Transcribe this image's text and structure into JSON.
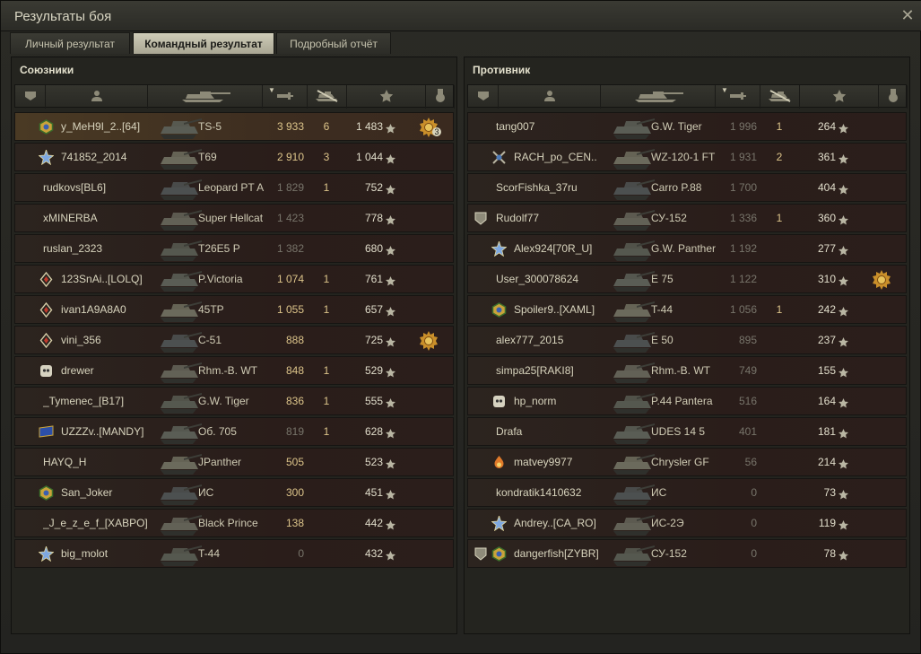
{
  "window": {
    "title": "Результаты боя",
    "close": "✕"
  },
  "tabs": [
    {
      "label": "Личный результат",
      "active": false
    },
    {
      "label": "Командный результат",
      "active": true
    },
    {
      "label": "Подробный отчёт",
      "active": false
    }
  ],
  "columns": [
    "rank-icon",
    "player-icon",
    "tank-icon",
    "damage-icon",
    "kills-icon",
    "experience-icon",
    "medal-icon"
  ],
  "colors": {
    "accent": "#dcc48a",
    "row_bg": "#2a1d1a",
    "highlight": "#4a3a24"
  },
  "allies": {
    "title": "Союзники",
    "players": [
      {
        "name": "y_MeH9I_2..[64]",
        "tank": "TS-5",
        "damage": "3 933",
        "kills": "6",
        "xp": "1 483",
        "badge": "hex-badge",
        "medal": "medal-icon",
        "medal_count": "3",
        "highlight": true
      },
      {
        "name": "741852_2014",
        "tank": "T69",
        "damage": "2 910",
        "kills": "3",
        "xp": "1 044",
        "badge": "star-badge"
      },
      {
        "name": "rudkovs[BL6]",
        "tank": "Leopard PT A",
        "damage": "1 829",
        "kills": "1",
        "xp": "752",
        "dim": true
      },
      {
        "name": "xMINERBA",
        "tank": "Super Hellcat",
        "damage": "1 423",
        "kills": "",
        "xp": "778",
        "dim": true
      },
      {
        "name": "ruslan_2323",
        "tank": "T26E5 P",
        "damage": "1 382",
        "kills": "",
        "xp": "680",
        "dim": true
      },
      {
        "name": "123SnAi..[LOLQ]",
        "tank": "P.Victoria",
        "damage": "1 074",
        "kills": "1",
        "xp": "761",
        "badge": "diamond-badge"
      },
      {
        "name": "ivan1A9A8A0",
        "tank": "45TP",
        "damage": "1 055",
        "kills": "1",
        "xp": "657",
        "badge": "diamond-badge"
      },
      {
        "name": "vini_356",
        "tank": "C-51",
        "damage": "888",
        "kills": "",
        "xp": "725",
        "badge": "diamond-badge",
        "medal": "medal-icon"
      },
      {
        "name": "drewer",
        "tank": "Rhm.-B. WT",
        "damage": "848",
        "kills": "1",
        "xp": "529",
        "badge": "skull-badge"
      },
      {
        "name": "_Tymenec_[B17]",
        "tank": "G.W. Tiger",
        "damage": "836",
        "kills": "1",
        "xp": "555"
      },
      {
        "name": "UZZZv..[MANDY]",
        "tank": "Об. 705",
        "damage": "819",
        "kills": "1",
        "xp": "628",
        "badge": "flag-badge",
        "dim": true
      },
      {
        "name": "HAYQ_H",
        "tank": "JPanther",
        "damage": "505",
        "kills": "",
        "xp": "523"
      },
      {
        "name": "San_Joker",
        "tank": "ИС",
        "damage": "300",
        "kills": "",
        "xp": "451",
        "badge": "hex-badge"
      },
      {
        "name": "_J_e_z_e_f_[XABPO]",
        "tank": "Black Prince",
        "damage": "138",
        "kills": "",
        "xp": "442"
      },
      {
        "name": "big_molot",
        "tank": "T-44",
        "damage": "0",
        "kills": "",
        "xp": "432",
        "badge": "star-badge",
        "dim": true
      }
    ]
  },
  "enemies": {
    "title": "Противник",
    "players": [
      {
        "name": "tang007",
        "tank": "G.W. Tiger",
        "damage": "1 996",
        "kills": "1",
        "xp": "264",
        "dim": true
      },
      {
        "name": "RACH_po_CEN..",
        "tank": "WZ-120-1 FT",
        "damage": "1 931",
        "kills": "2",
        "xp": "361",
        "badge": "crossed-badge",
        "dim": true
      },
      {
        "name": "ScorFishka_37ru",
        "tank": "Carro P.88",
        "damage": "1 700",
        "kills": "",
        "xp": "404",
        "dim": true
      },
      {
        "name": "Rudolf77",
        "tank": "СУ-152",
        "damage": "1 336",
        "kills": "1",
        "xp": "360",
        "rank": "shield-rank",
        "dim": true
      },
      {
        "name": "Alex924[70R_U]",
        "tank": "G.W. Panther",
        "damage": "1 192",
        "kills": "",
        "xp": "277",
        "badge": "star-badge",
        "dim": true
      },
      {
        "name": "User_300078624",
        "tank": "E 75",
        "damage": "1 122",
        "kills": "",
        "xp": "310",
        "medal": "medal-icon",
        "dim": true
      },
      {
        "name": "Spoiler9..[XAML]",
        "tank": "T-44",
        "damage": "1 056",
        "kills": "1",
        "xp": "242",
        "badge": "hex-badge",
        "dim": true
      },
      {
        "name": "alex777_2015",
        "tank": "E 50",
        "damage": "895",
        "kills": "",
        "xp": "237",
        "dim": true
      },
      {
        "name": "simpa25[RAKI8]",
        "tank": "Rhm.-B. WT",
        "damage": "749",
        "kills": "",
        "xp": "155",
        "dim": true
      },
      {
        "name": "hp_norm",
        "tank": "P.44 Pantera",
        "damage": "516",
        "kills": "",
        "xp": "164",
        "badge": "skull-badge",
        "dim": true
      },
      {
        "name": "Drafa",
        "tank": "UDES 14 5",
        "damage": "401",
        "kills": "",
        "xp": "181",
        "dim": true
      },
      {
        "name": "matvey9977",
        "tank": "Chrysler GF",
        "damage": "56",
        "kills": "",
        "xp": "214",
        "badge": "flame-badge",
        "dim": true
      },
      {
        "name": "kondratik1410632",
        "tank": "ИС",
        "damage": "0",
        "kills": "",
        "xp": "73",
        "dim": true
      },
      {
        "name": "Andrey..[CA_RO]",
        "tank": "ИС-2Э",
        "damage": "0",
        "kills": "",
        "xp": "119",
        "badge": "star-badge",
        "dim": true
      },
      {
        "name": "dangerfish[ZYBR]",
        "tank": "СУ-152",
        "damage": "0",
        "kills": "",
        "xp": "78",
        "rank": "shield-rank",
        "badge": "hex-badge",
        "dim": true
      }
    ]
  }
}
